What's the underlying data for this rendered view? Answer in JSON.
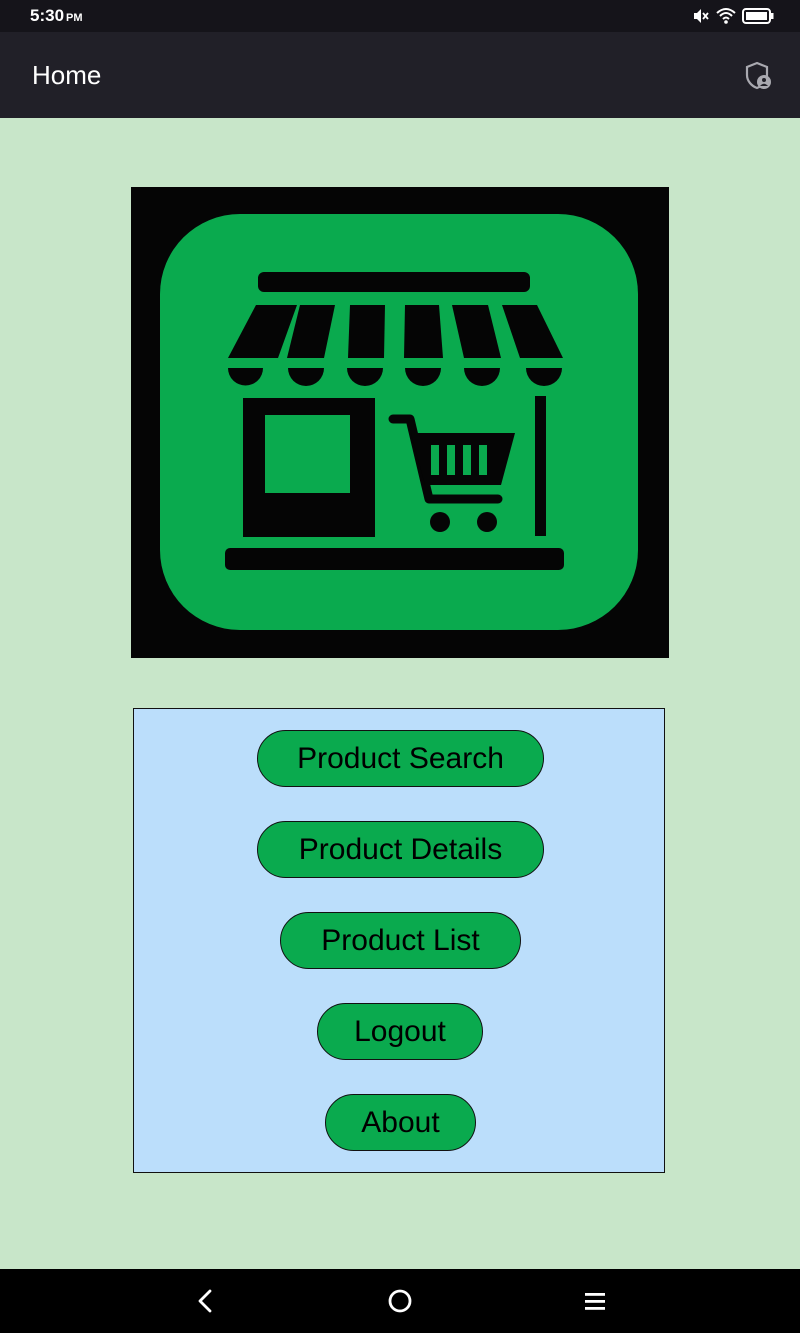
{
  "status_bar": {
    "time": "5:30",
    "ampm": "PM",
    "icons": [
      "mute-icon",
      "wifi-icon",
      "battery-icon"
    ]
  },
  "app_bar": {
    "title": "Home",
    "action_icon": "shield-account-icon"
  },
  "logo": {
    "icon": "storefront-cart-icon",
    "background_color": "#050505",
    "tile_color": "#0aaa4e"
  },
  "menu": {
    "buttons": [
      {
        "label": "Product Search"
      },
      {
        "label": "Product Details"
      },
      {
        "label": "Product List"
      },
      {
        "label": "Logout"
      },
      {
        "label": "About"
      }
    ]
  },
  "nav_bar": {
    "items": [
      "back-icon",
      "home-icon",
      "recents-icon"
    ]
  },
  "colors": {
    "page_background": "#c8e6c9",
    "panel_background": "#bbdefb",
    "button_fill": "#0aaa4e",
    "app_bar": "#212028",
    "status_bar": "#15141a"
  }
}
